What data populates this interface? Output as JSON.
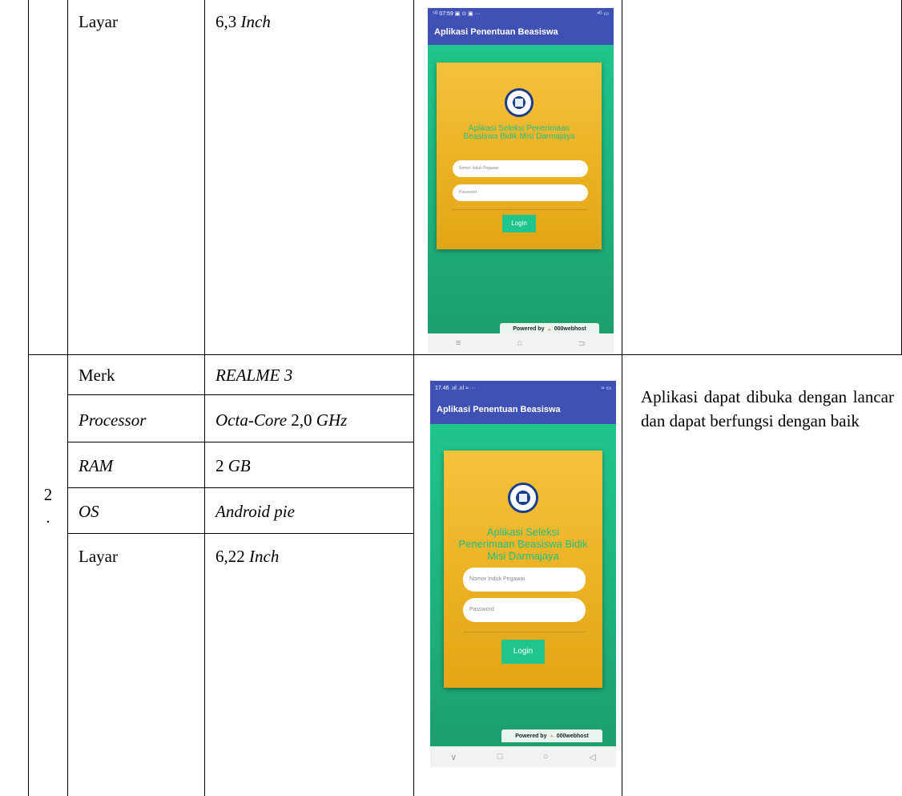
{
  "row1": {
    "label": "Layar",
    "value_num": "6,3",
    "value_unit": "Inch"
  },
  "row2": {
    "number": "2",
    "number_dot": ".",
    "specs": [
      {
        "label": "Merk",
        "value": "REALME 3"
      },
      {
        "label": "Processor",
        "value_a": "Octa-Core",
        "value_b": "2,0",
        "value_c": "GHz"
      },
      {
        "label": "RAM",
        "value_a": "2",
        "value_b": "GB"
      },
      {
        "label": "OS",
        "value": "Android pie"
      },
      {
        "label": "Layar",
        "value_a": "6,22",
        "value_b": "Inch"
      }
    ],
    "remark": "Aplikasi dapat dibuka dengan lancar dan dapat berfungsi dengan baik"
  },
  "phone1": {
    "status_left": "⁵ᴳ 07:59 ▣ ⊙ ▣ ···",
    "status_right": "⁴ᴳ ▭",
    "app_title": "Aplikasi Penentuan Beasiswa",
    "card_title": "Aplikasi Seleksi Penerimaan Beasiswa Bidik Misi Darmajaya",
    "nip_placeholder": "Nomor Induk Pegawai",
    "password_placeholder": "Password",
    "login_label": "Login",
    "powered_by": "Powered by",
    "host": "000webhost",
    "nav_menu": "≡",
    "nav_home": "⌂",
    "nav_back": "⊃"
  },
  "phone2": {
    "status_left": "17.46 .ııl .ııl ≈ ···",
    "status_right": "≈ ▭",
    "app_title": "Aplikasi Penentuan Beasiswa",
    "card_title": "Aplikasi Seleksi Penerimaan Beasiswa Bidik Misi Darmajaya",
    "nip_placeholder": "Nomor Induk Pegawai",
    "password_placeholder": "Password",
    "login_label": "Login",
    "powered_by": "Powered by",
    "host": "000webhost",
    "nav_down": "∨",
    "nav_square": "□",
    "nav_circle": "○",
    "nav_back": "◁"
  }
}
